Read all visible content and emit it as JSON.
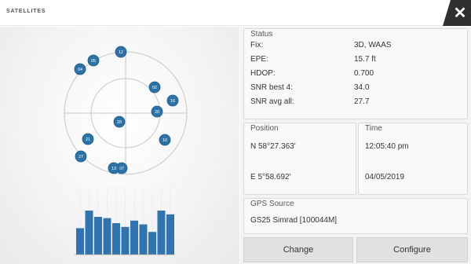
{
  "window": {
    "title": "SATELLITES",
    "close_label": "✕"
  },
  "status": {
    "heading": "Status",
    "rows": [
      {
        "label": "Fix:",
        "value": "3D, WAAS"
      },
      {
        "label": "EPE:",
        "value": "15.7 ft"
      },
      {
        "label": "HDOP:",
        "value": "0.700"
      },
      {
        "label": "SNR best 4:",
        "value": "34.0"
      },
      {
        "label": "SNR avg all:",
        "value": "27.7"
      }
    ]
  },
  "position": {
    "heading": "Position",
    "lat": "N  58°27.363'",
    "lon": "E  5°58.692'"
  },
  "time": {
    "heading": "Time",
    "time": "12:05:40 pm",
    "date": "04/05/2019"
  },
  "gps_source": {
    "heading": "GPS Source",
    "value": "GS25 Simrad [100044M]"
  },
  "buttons": {
    "change": "Change",
    "configure": "Configure"
  },
  "colors": {
    "satellite": "#2a72a8",
    "bar": "#2f73b1",
    "close_bg": "#303030"
  },
  "signal_bars": [
    0.42,
    0.7,
    0.6,
    0.58,
    0.5,
    0.44,
    0.54,
    0.48,
    0.36,
    0.7,
    0.64
  ],
  "satellites": [
    {
      "id": "12"
    },
    {
      "id": "05"
    },
    {
      "id": "04"
    },
    {
      "id": "02"
    },
    {
      "id": "16"
    },
    {
      "id": "20"
    },
    {
      "id": "29"
    },
    {
      "id": "10"
    },
    {
      "id": "21"
    },
    {
      "id": "27"
    },
    {
      "id": "07"
    },
    {
      "id": "13"
    }
  ]
}
